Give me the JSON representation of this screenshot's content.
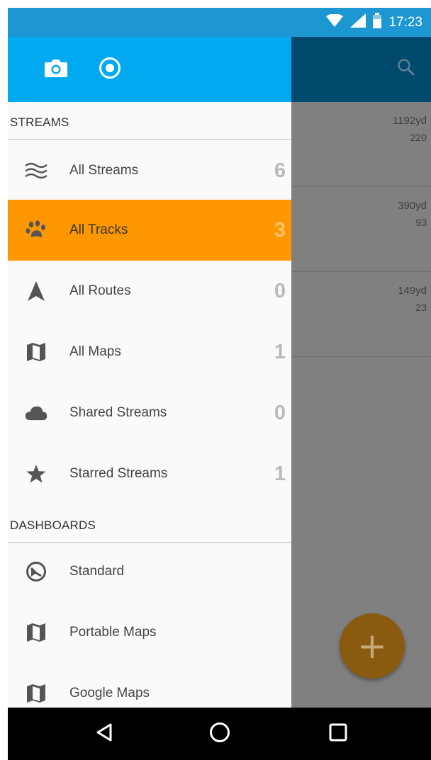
{
  "status_bar": {
    "time": "17:23"
  },
  "drawer": {
    "sections": [
      {
        "title": "STREAMS"
      },
      {
        "title": "DASHBOARDS"
      }
    ],
    "streams": [
      {
        "label": "All Streams",
        "count": "6",
        "icon": "waves-icon"
      },
      {
        "label": "All Tracks",
        "count": "3",
        "icon": "paw-icon",
        "active": true
      },
      {
        "label": "All Routes",
        "count": "0",
        "icon": "navigation-arrow-icon"
      },
      {
        "label": "All Maps",
        "count": "1",
        "icon": "map-icon"
      },
      {
        "label": "Shared Streams",
        "count": "0",
        "icon": "cloud-icon"
      },
      {
        "label": "Starred Streams",
        "count": "1",
        "icon": "star-icon"
      }
    ],
    "dashboards": [
      {
        "label": "Standard",
        "icon": "gauge-icon"
      },
      {
        "label": "Portable Maps",
        "icon": "map-icon"
      },
      {
        "label": "Google Maps",
        "icon": "map-icon"
      }
    ]
  },
  "list": {
    "rows": [
      {
        "distance": "1192yd",
        "count": "220"
      },
      {
        "distance": "390yd",
        "count": "93"
      },
      {
        "distance": "149yd",
        "count": "23"
      }
    ]
  },
  "colors": {
    "status_bar": "#1c97d2",
    "drawer_header": "#00a9f0",
    "active_item": "#ff9800",
    "right_header_dim": "#004a6e",
    "fab_dim": "#8a5a10"
  }
}
